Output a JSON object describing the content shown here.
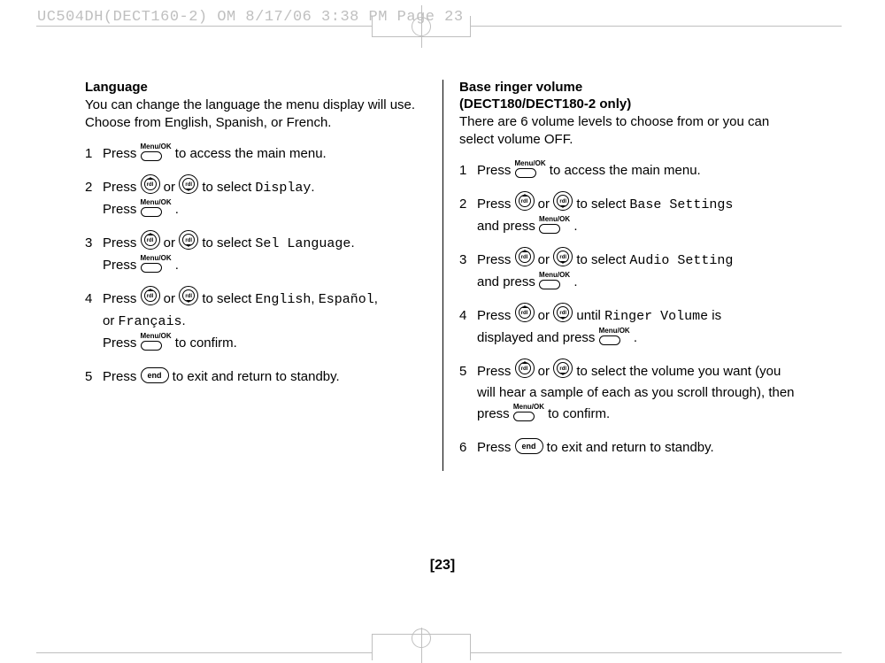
{
  "crop_header": "UC504DH(DECT160-2) OM  8/17/06  3:38 PM  Page 23",
  "page_number": "[23]",
  "icons": {
    "menuok_label": "Menu/OK",
    "end_label": "end"
  },
  "left": {
    "heading": "Language",
    "intro": "You can change the language the menu display will use. Choose from English, Spanish, or French.",
    "steps": [
      {
        "n": "1",
        "pre": "Press ",
        "post": " to access the main menu."
      },
      {
        "n": "2",
        "pre": "Press ",
        "mid": " or ",
        "post1": " to select ",
        "opt": "Display",
        "post2": ".",
        "line2a": "Press ",
        "line2b": " ."
      },
      {
        "n": "3",
        "pre": "Press ",
        "mid": " or ",
        "post1": " to select ",
        "opt": "Sel Language",
        "post2": ".",
        "line2a": "Press ",
        "line2b": " ."
      },
      {
        "n": "4",
        "pre": "Press ",
        "mid": " or ",
        "post1": " to select ",
        "opt1": "English",
        "comma": ", ",
        "opt2": "Español",
        "comma2": ",",
        "line2": "or ",
        "opt3": "Français",
        "period": ".",
        "line3a": "Press ",
        "line3b": " to confirm."
      },
      {
        "n": "5",
        "pre": "Press ",
        "post": " to exit and return to standby."
      }
    ]
  },
  "right": {
    "heading1": "Base ringer volume",
    "heading2": "(DECT180/DECT180-2 only)",
    "intro": "There are 6 volume levels to choose from or you can select volume OFF.",
    "steps": [
      {
        "n": "1",
        "pre": "Press ",
        "post": " to access the main menu."
      },
      {
        "n": "2",
        "pre": "Press ",
        "mid": " or ",
        "post1": " to select ",
        "opt": "Base Settings",
        "line2a": "and press ",
        "line2b": " ."
      },
      {
        "n": "3",
        "pre": "Press ",
        "mid": " or ",
        "post1": " to select ",
        "opt": "Audio Setting",
        "line2a": "and press ",
        "line2b": " ."
      },
      {
        "n": "4",
        "pre": "Press ",
        "mid": " or ",
        "post1": " until ",
        "opt": "Ringer Volume",
        "post2": " is",
        "line2a": "displayed and press ",
        "line2b": " ."
      },
      {
        "n": "5",
        "pre": "Press ",
        "mid": " or ",
        "post1": " to select the volume you want (you will hear a sample of each as you scroll through), then press ",
        "post2": " to confirm."
      },
      {
        "n": "6",
        "pre": "Press ",
        "post": " to exit and return to standby."
      }
    ]
  }
}
